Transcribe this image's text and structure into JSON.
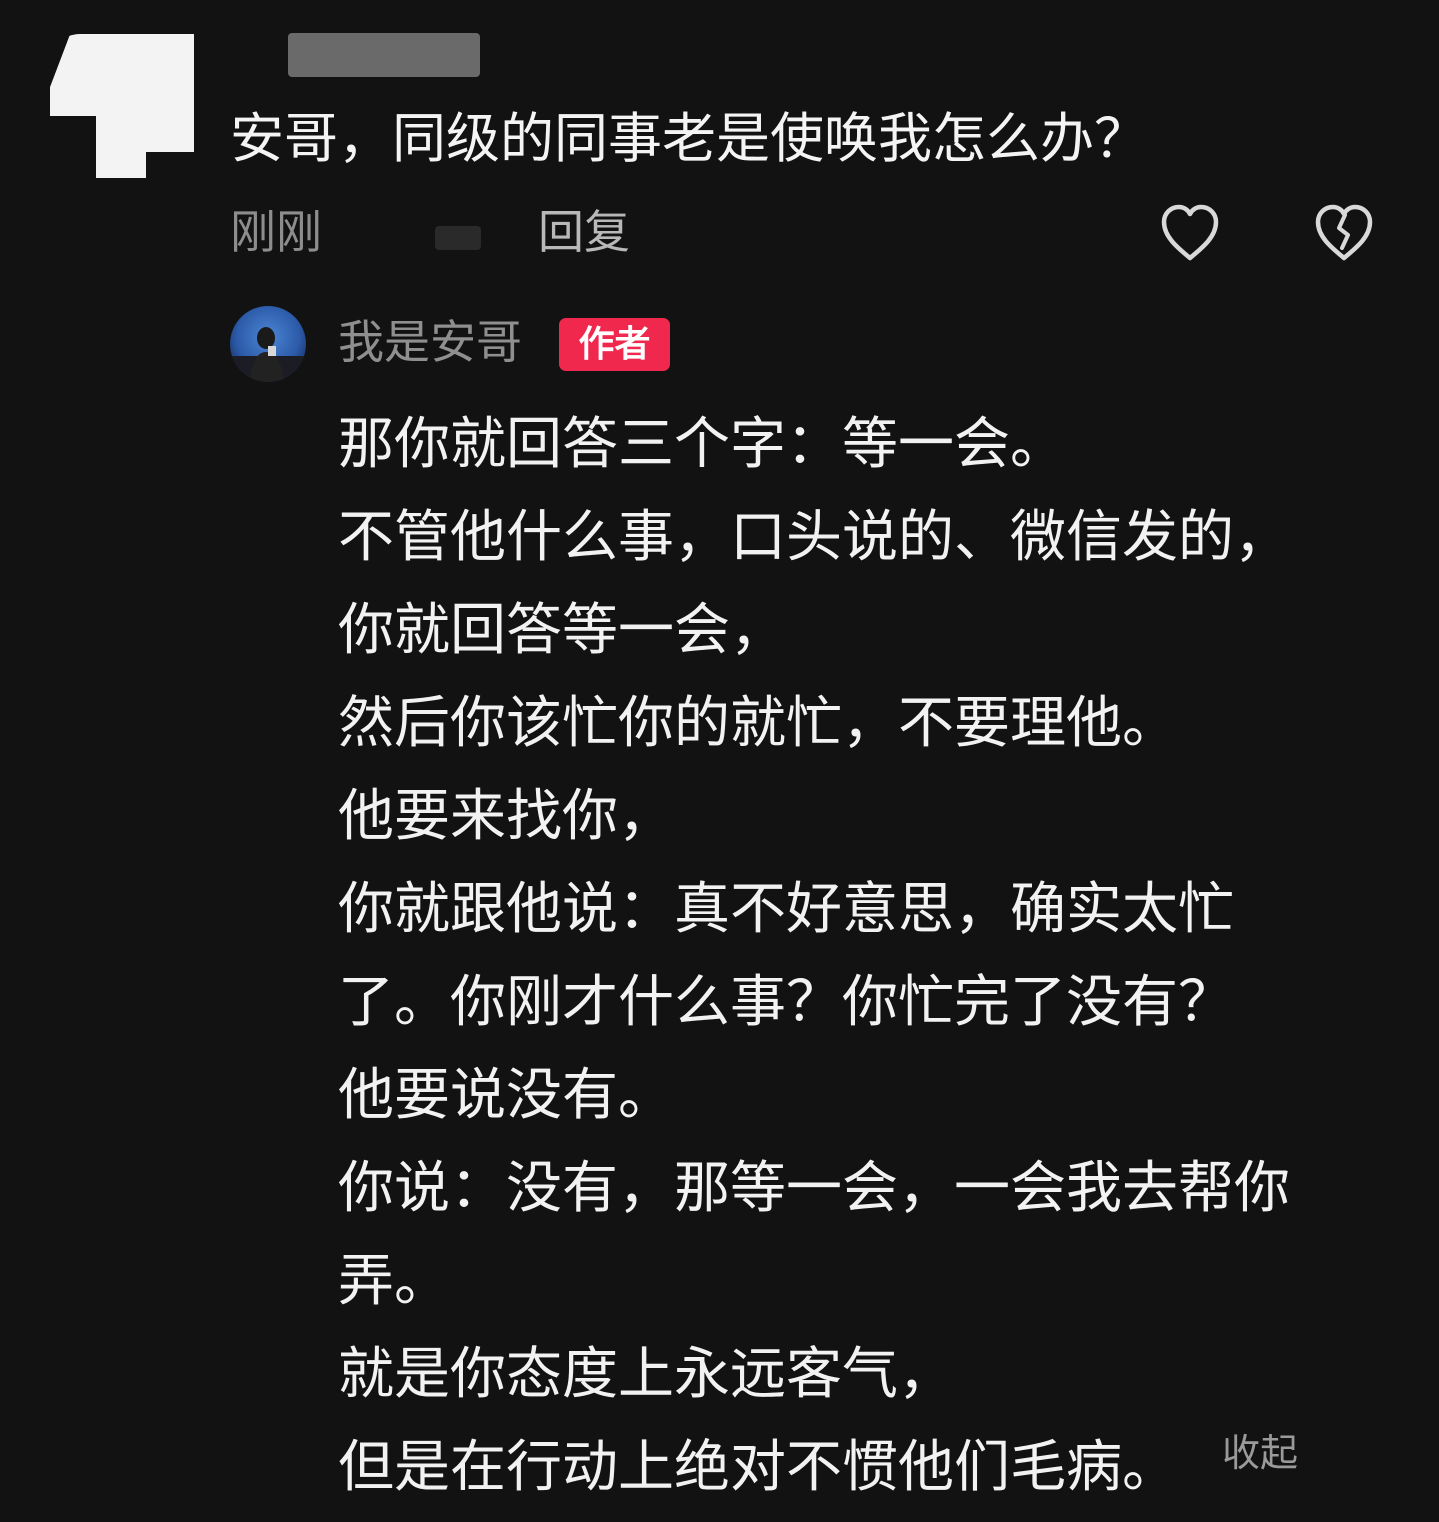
{
  "theme": {
    "background": "#121212",
    "badge_color": "#f0284d",
    "muted_text": "#8d8d8d"
  },
  "comment": {
    "avatar_icon": "redacted-avatar",
    "question": "安哥，同级的同事老是使唤我怎么办？",
    "time": "刚刚",
    "reply_label": "回复",
    "like_icon": "heart-outline-icon",
    "dislike_icon": "broken-heart-icon"
  },
  "reply": {
    "author_name": "我是安哥",
    "author_badge": "作者",
    "lines": [
      "那你就回答三个字：等一会。",
      "不管他什么事，口头说的、微信发的，",
      "你就回答等一会，",
      "然后你该忙你的就忙，不要理他。",
      "他要来找你，",
      "你就跟他说：真不好意思，确实太忙",
      "了。你刚才什么事？你忙完了没有？",
      "他要说没有。",
      "你说：没有，那等一会，一会我去帮你",
      "弄。",
      "就是你态度上永远客气，",
      "但是在行动上绝对不惯他们毛病。"
    ],
    "collapse_label": "收起"
  }
}
